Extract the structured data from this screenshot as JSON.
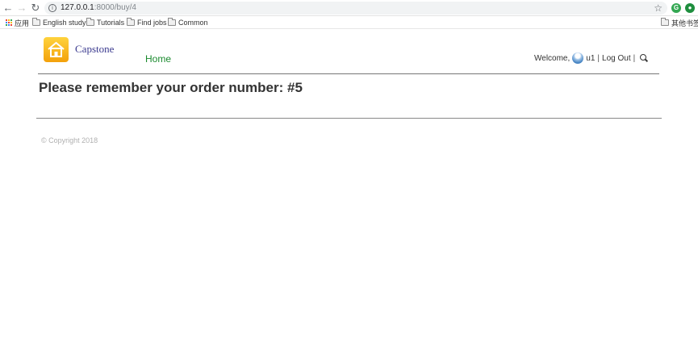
{
  "browser": {
    "url_host": "127.0.0.1",
    "url_rest": ":8000/buy/4",
    "bookmarks": {
      "apps": "应用",
      "items": [
        "English study",
        "Tutorials",
        "Find jobs",
        "Common"
      ],
      "other": "其他书签"
    }
  },
  "site": {
    "brand": "Capstone",
    "nav_home": "Home",
    "welcome": "Welcome,",
    "username": "u1",
    "separator": "|",
    "logout": "Log Out"
  },
  "main": {
    "title": "Please remember your order number: #5"
  },
  "footer": {
    "copyright": "© Copyright 2018"
  },
  "colors": {
    "brand": "#3b3a8f",
    "nav_link": "#1a8a2e",
    "logo": "#f7b218"
  }
}
